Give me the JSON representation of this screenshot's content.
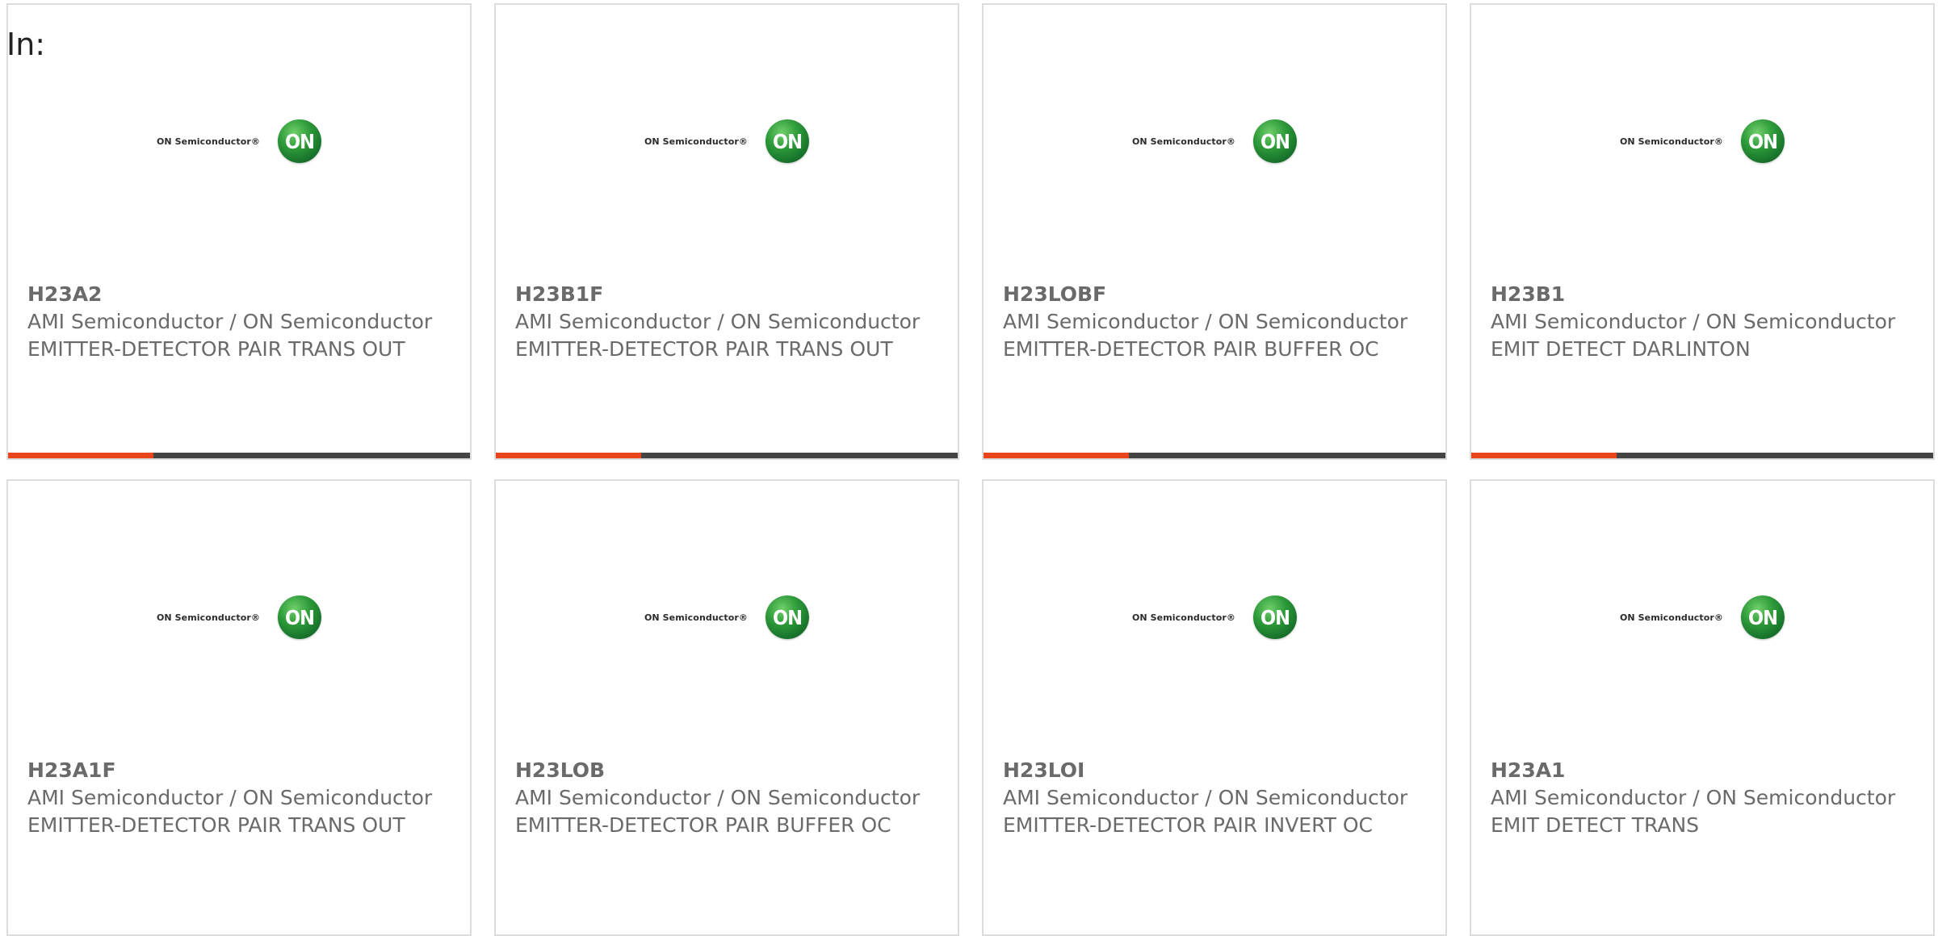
{
  "filter": {
    "label": "In:"
  },
  "brand": {
    "logo_text": "ON Semiconductor®",
    "logo_mark": "ON",
    "logo_color": "#1f8a34"
  },
  "accent_color": "#e8461a",
  "products": [
    {
      "part": "H23A2",
      "manufacturer": "AMI Semiconductor / ON Semiconductor",
      "description": "EMITTER-DETECTOR PAIR TRANS OUT"
    },
    {
      "part": "H23B1F",
      "manufacturer": "AMI Semiconductor / ON Semiconductor",
      "description": "EMITTER-DETECTOR PAIR TRANS OUT"
    },
    {
      "part": "H23LOBF",
      "manufacturer": "AMI Semiconductor / ON Semiconductor",
      "description": "EMITTER-DETECTOR PAIR BUFFER OC"
    },
    {
      "part": "H23B1",
      "manufacturer": "AMI Semiconductor / ON Semiconductor",
      "description": "EMIT DETECT DARLINTON"
    },
    {
      "part": "H23A1F",
      "manufacturer": "AMI Semiconductor / ON Semiconductor",
      "description": "EMITTER-DETECTOR PAIR TRANS OUT"
    },
    {
      "part": "H23LOB",
      "manufacturer": "AMI Semiconductor / ON Semiconductor",
      "description": "EMITTER-DETECTOR PAIR BUFFER OC"
    },
    {
      "part": "H23LOI",
      "manufacturer": "AMI Semiconductor / ON Semiconductor",
      "description": "EMITTER-DETECTOR PAIR INVERT OC"
    },
    {
      "part": "H23A1",
      "manufacturer": "AMI Semiconductor / ON Semiconductor",
      "description": "EMIT DETECT TRANS"
    }
  ]
}
